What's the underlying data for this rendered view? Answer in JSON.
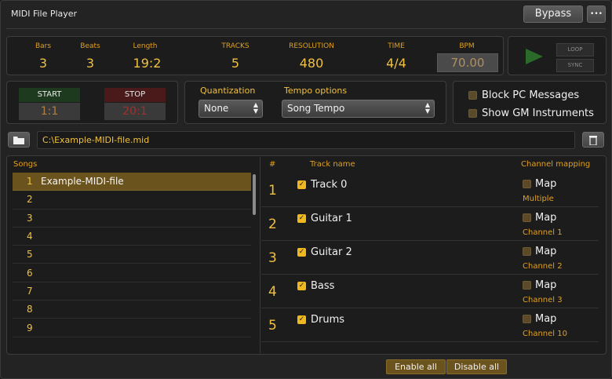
{
  "window": {
    "title": "MIDI File Player"
  },
  "header": {
    "bypass_label": "Bypass",
    "more_label": "•••"
  },
  "stats": {
    "bars": {
      "label": "Bars",
      "value": "3"
    },
    "beats": {
      "label": "Beats",
      "value": "3"
    },
    "length": {
      "label": "Length",
      "value": "19:2"
    },
    "tracks": {
      "label": "TRACKS",
      "value": "5"
    },
    "resolution": {
      "label": "RESOLUTION",
      "value": "480"
    },
    "time": {
      "label": "TIME",
      "value": "4/4"
    },
    "bpm": {
      "label": "BPM",
      "value": "70.00"
    }
  },
  "transport": {
    "loop_label": "LOOP",
    "sync_label": "SYNC",
    "play_icon": "play-icon"
  },
  "range": {
    "start_label": "START",
    "start_value": "1:1",
    "stop_label": "STOP",
    "stop_value": "20:1"
  },
  "quantization": {
    "label": "Quantization",
    "value": "None"
  },
  "tempo": {
    "label": "Tempo options",
    "value": "Song Tempo"
  },
  "options": {
    "block_pc": "Block PC Messages",
    "show_gm": "Show GM Instruments"
  },
  "file": {
    "path": "C:\\Example-MIDI-file.mid",
    "folder_icon": "folder-icon",
    "trash_icon": "trash-icon"
  },
  "songs": {
    "header": "Songs",
    "items": [
      {
        "num": "1",
        "name": "Example-MIDI-file"
      },
      {
        "num": "2",
        "name": ""
      },
      {
        "num": "3",
        "name": ""
      },
      {
        "num": "4",
        "name": ""
      },
      {
        "num": "5",
        "name": ""
      },
      {
        "num": "6",
        "name": ""
      },
      {
        "num": "7",
        "name": ""
      },
      {
        "num": "8",
        "name": ""
      },
      {
        "num": "9",
        "name": ""
      }
    ]
  },
  "tracks": {
    "headers": {
      "num": "#",
      "name": "Track name",
      "mapping": "Channel mapping"
    },
    "map_label": "Map",
    "items": [
      {
        "num": "1",
        "name": "Track 0",
        "channel": "Multiple"
      },
      {
        "num": "2",
        "name": "Guitar 1",
        "channel": "Channel 1"
      },
      {
        "num": "3",
        "name": "Guitar 2",
        "channel": "Channel 2"
      },
      {
        "num": "4",
        "name": "Bass",
        "channel": "Channel 3"
      },
      {
        "num": "5",
        "name": "Drums",
        "channel": "Channel 10"
      }
    ]
  },
  "footer": {
    "enable_all": "Enable all",
    "disable_all": "Disable all"
  }
}
